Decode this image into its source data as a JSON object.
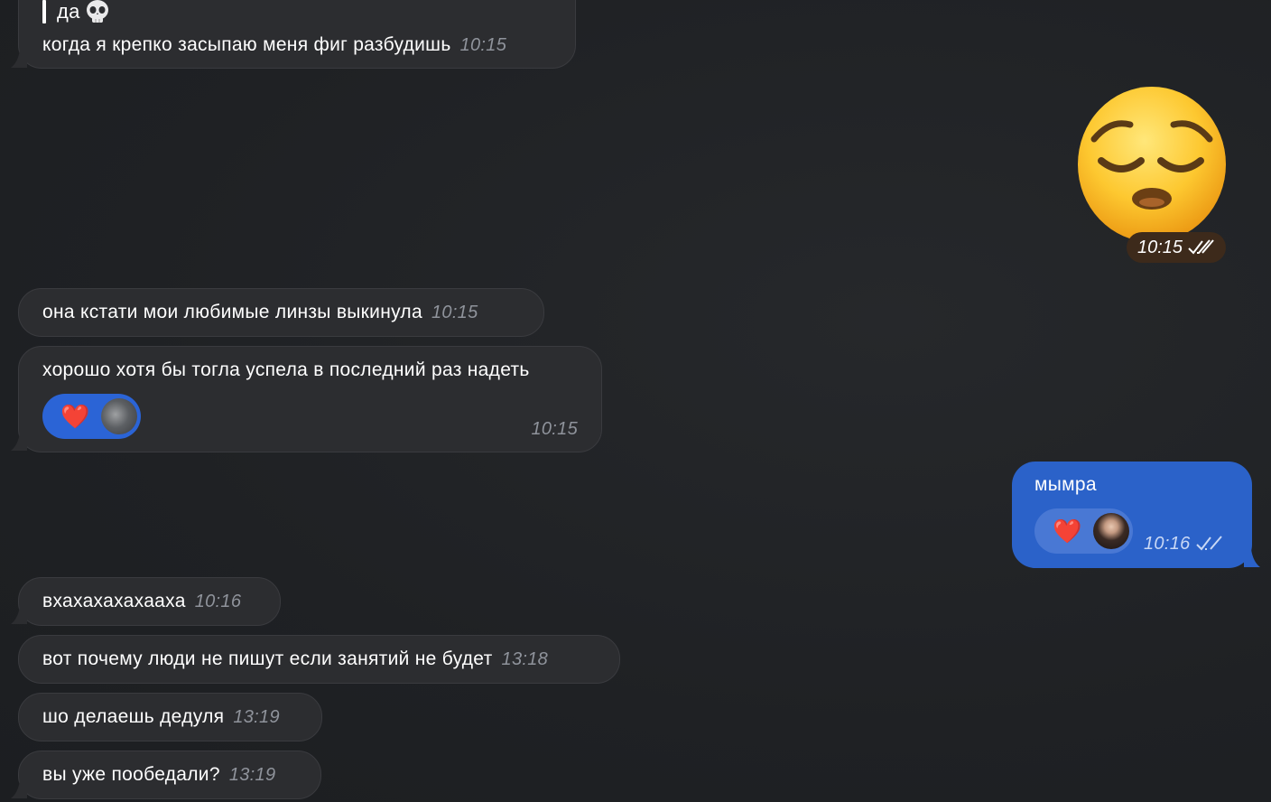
{
  "messages": {
    "m1": {
      "reply_quote": "да",
      "text": "когда я крепко засыпаю меня фиг разбудишь",
      "time": "10:15"
    },
    "m2": {
      "time": "10:15",
      "emoji": "pensive-face"
    },
    "m3": {
      "text": "она кстати мои любимые линзы выкинула",
      "time": "10:15"
    },
    "m4": {
      "text": "хорошо хотя бы тогла успела в последний раз надеть",
      "time": "10:15",
      "reaction": "❤️"
    },
    "m5": {
      "text": "мымра",
      "time": "10:16",
      "reaction": "❤️"
    },
    "m6": {
      "text": "вхахахахахааха",
      "time": "10:16"
    },
    "m7": {
      "text": "вот почему люди не пишут если занятий не будет",
      "time": "13:18"
    },
    "m8": {
      "text": "шо делаешь дедуля",
      "time": "13:19"
    },
    "m9": {
      "text": "вы уже пообедали?",
      "time": "13:19"
    }
  },
  "reactions": {
    "heart": "❤️"
  },
  "colors": {
    "background": "#202225",
    "incoming_bubble": "#2c2d30",
    "outgoing_bubble": "#2b62c9",
    "reaction_blue": "#2b64d6",
    "heart_red": "#e12a3c"
  }
}
